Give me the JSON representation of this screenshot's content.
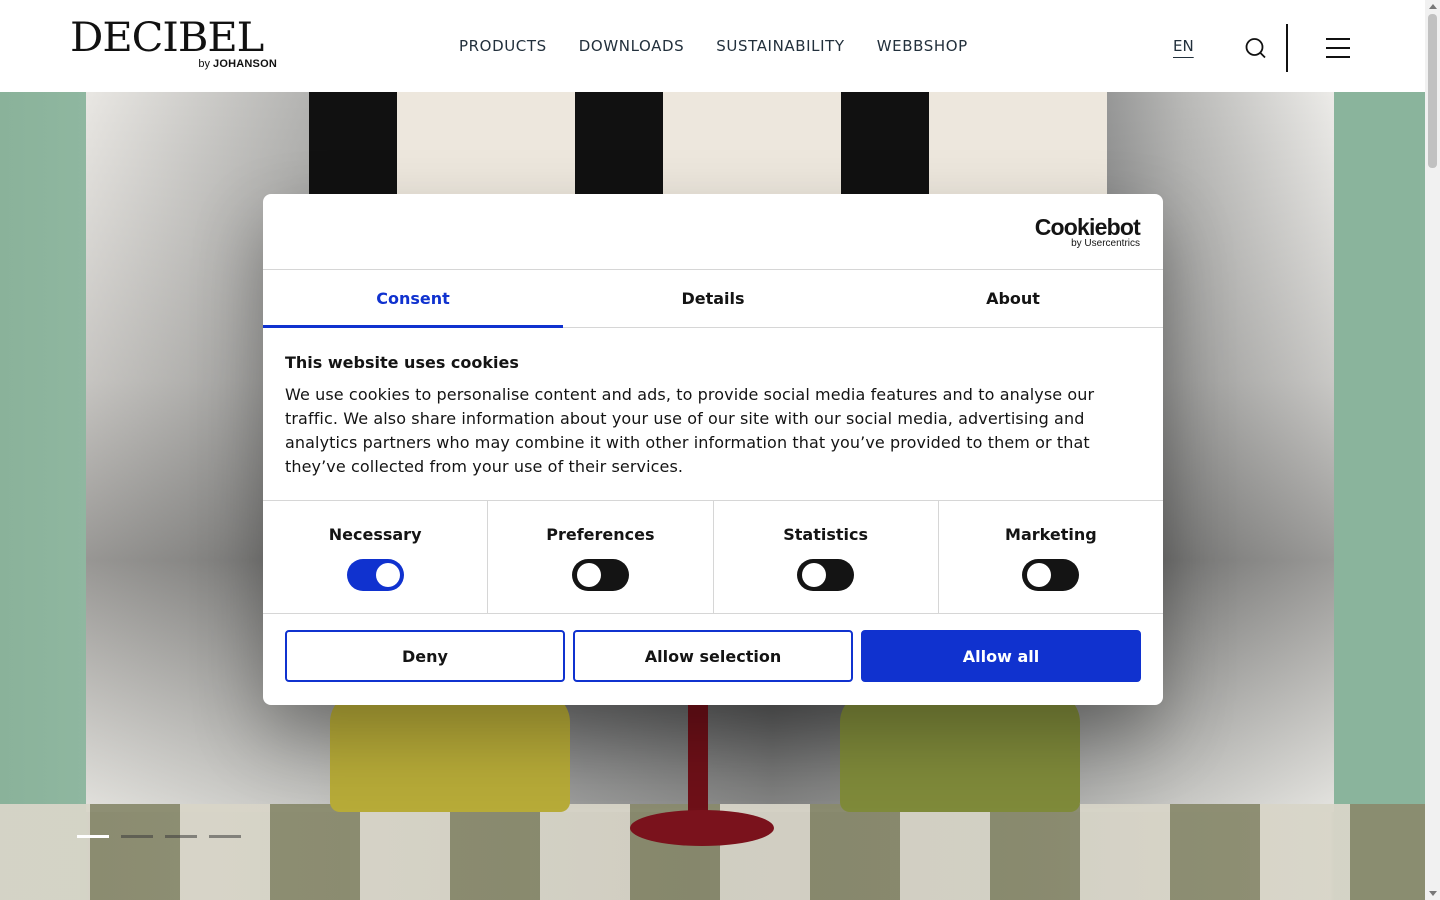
{
  "header": {
    "logo": {
      "word": "DECIBEL",
      "sub_by": "by",
      "sub_brand": "JOHANSON"
    },
    "nav": [
      "PRODUCTS",
      "DOWNLOADS",
      "SUSTAINABILITY",
      "WEBBSHOP"
    ],
    "language": "EN",
    "icons": {
      "search": "search-icon",
      "menu": "hamburger-menu-icon"
    }
  },
  "hero": {
    "slides_total": 4,
    "active_slide": 1
  },
  "cookie": {
    "brand": "Cookiebot",
    "brand_sub": "by Usercentrics",
    "tabs": [
      "Consent",
      "Details",
      "About"
    ],
    "active_tab": "Consent",
    "title": "This website uses cookies",
    "text": "We use cookies to personalise content and ads, to provide social media features and to analyse our traffic. We also share information about your use of our site with our social media, advertising and analytics partners who may combine it with other information that you’ve provided to them or that they’ve collected from your use of their services.",
    "toggles": [
      {
        "label": "Necessary",
        "on": true
      },
      {
        "label": "Preferences",
        "on": false
      },
      {
        "label": "Statistics",
        "on": false
      },
      {
        "label": "Marketing",
        "on": false
      }
    ],
    "buttons": {
      "deny": "Deny",
      "allow_selection": "Allow selection",
      "allow_all": "Allow all"
    },
    "colors": {
      "accent": "#1032cf",
      "text": "#141414"
    }
  }
}
